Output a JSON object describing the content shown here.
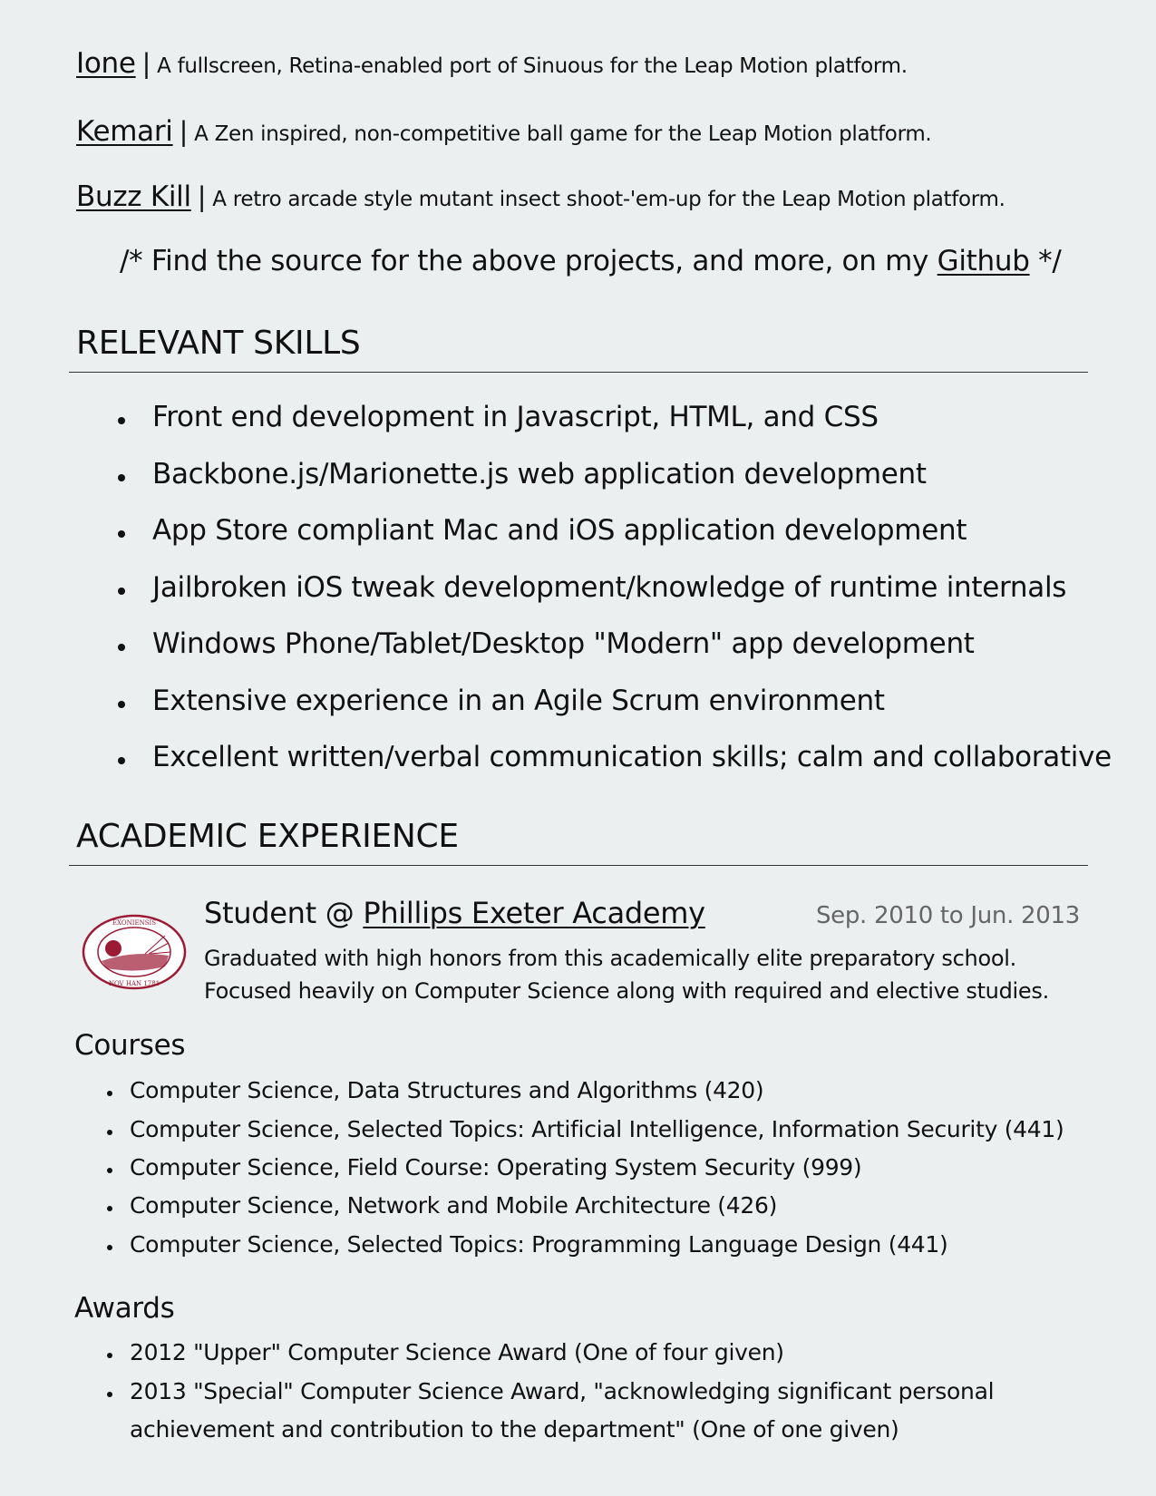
{
  "projects": [
    {
      "name": "Ione",
      "sep": "|",
      "desc": "A fullscreen, Retina-enabled port of Sinuous for the Leap Motion platform."
    },
    {
      "name": "Kemari",
      "sep": "|",
      "desc": "A Zen inspired, non-competitive ball game for the Leap Motion platform."
    },
    {
      "name": "Buzz Kill",
      "sep": "|",
      "desc": "A retro arcade style mutant insect shoot-'em-up for the Leap Motion platform."
    }
  ],
  "source_note": {
    "before": "/* Find the source for the above projects, and more, on my",
    "link": "Github",
    "after": "*/"
  },
  "skills": {
    "heading": "RELEVANT SKILLS",
    "items": [
      "Front end development in Javascript, HTML, and CSS",
      "Backbone.js/Marionette.js web application development",
      "App Store compliant Mac and iOS application development",
      "Jailbroken iOS tweak development/knowledge of runtime internals",
      "Windows Phone/Tablet/Desktop \"Modern\" app development",
      "Extensive experience in an Agile Scrum environment",
      "Excellent written/verbal communication skills; calm and collaborative"
    ]
  },
  "academic": {
    "heading": "ACADEMIC EXPERIENCE",
    "role": "Student @",
    "school": "Phillips Exeter Academy",
    "dates": "Sep. 2010 to Jun. 2013",
    "desc": [
      "Graduated with high honors from this academically elite preparatory school.",
      "Focused heavily on Computer Science along with required and elective studies."
    ],
    "seal_text": "SIGILL PHILLIP EXONIENSIS ACADEMIAE · NOV HAN 1781",
    "seal_color": "#9b1b35",
    "courses_heading": "Courses",
    "courses": [
      "Computer Science, Data Structures and Algorithms (420)",
      "Computer Science, Selected Topics: Artificial Intelligence, Information Security (441)",
      "Computer Science, Field Course: Operating System Security (999)",
      "Computer Science, Network and Mobile Architecture (426)",
      "Computer Science, Selected Topics: Programming Language Design (441)"
    ],
    "awards_heading": "Awards",
    "awards": [
      "2012 \"Upper\" Computer Science Award (One of four given)",
      "2013 \"Special\" Computer Science Award, \"acknowledging significant personal",
      "achievement and contribution to the department\" (One of one given)"
    ]
  }
}
